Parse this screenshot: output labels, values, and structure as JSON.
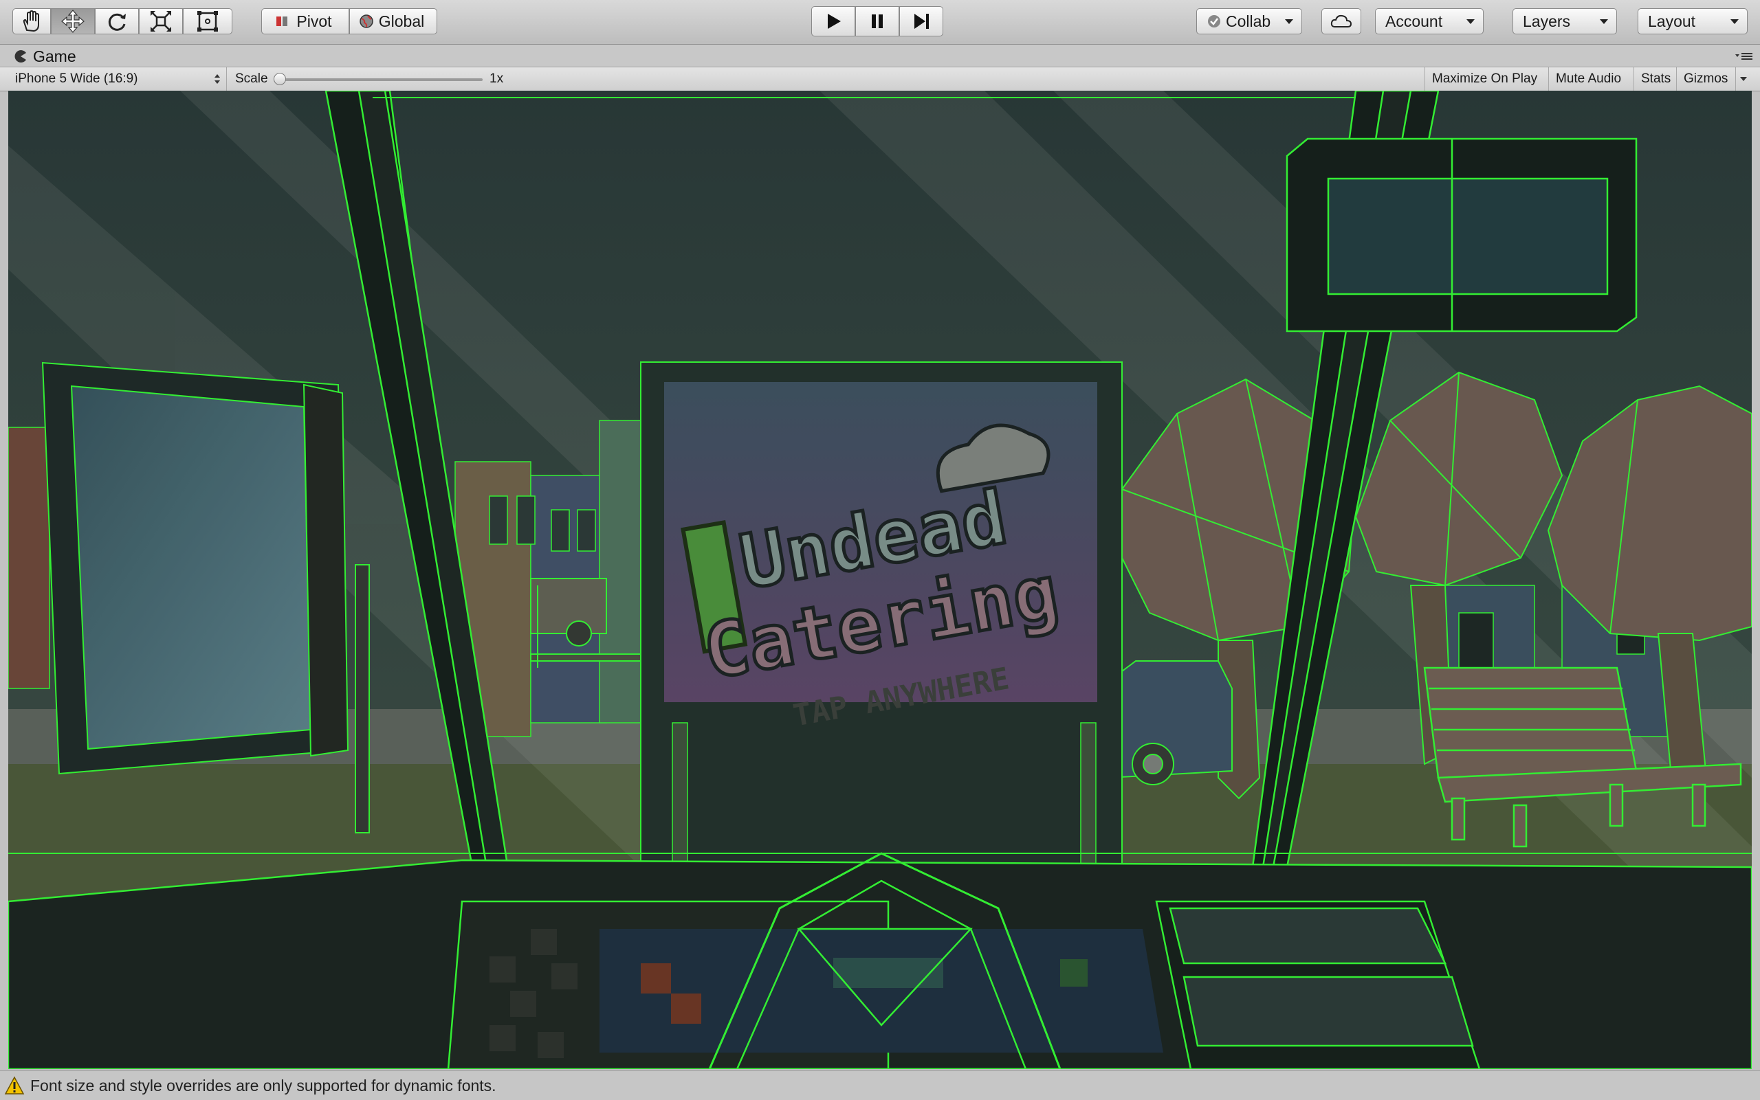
{
  "toolbar": {
    "tools": [
      {
        "name": "hand-tool",
        "icon": "hand-icon"
      },
      {
        "name": "move-tool",
        "icon": "move-arrows-icon",
        "active": true
      },
      {
        "name": "rotate-tool",
        "icon": "rotate-icon"
      },
      {
        "name": "scale-tool",
        "icon": "scale-icon"
      },
      {
        "name": "rect-tool",
        "icon": "rect-transform-icon"
      }
    ],
    "pivot_label": "Pivot",
    "global_label": "Global",
    "play_icon": "play-icon",
    "pause_icon": "pause-icon",
    "step_icon": "step-icon",
    "collab_label": "Collab",
    "cloud_icon": "cloud-icon",
    "account_label": "Account",
    "layers_label": "Layers",
    "layout_label": "Layout"
  },
  "tab": {
    "title": "Game"
  },
  "gamebar": {
    "resolution": "iPhone 5 Wide (16:9)",
    "scale_label": "Scale",
    "scale_value": "1x",
    "scale_level": 0,
    "maximize_label": "Maximize On Play",
    "mute_label": "Mute Audio",
    "stats_label": "Stats",
    "gizmos_label": "Gizmos"
  },
  "game": {
    "logo_line1": "Undead",
    "logo_line2": "Catering",
    "tap_text": "TAP ANYWHERE"
  },
  "status": {
    "message": "Font size and style overrides are only supported for dynamic fonts.",
    "icon": "warning-icon"
  },
  "colors": {
    "wireframe": "#33ee33",
    "toolbar_bg": "#c8c8c8",
    "viewport_dark": "#2b3336",
    "warning": "#f2c200"
  }
}
